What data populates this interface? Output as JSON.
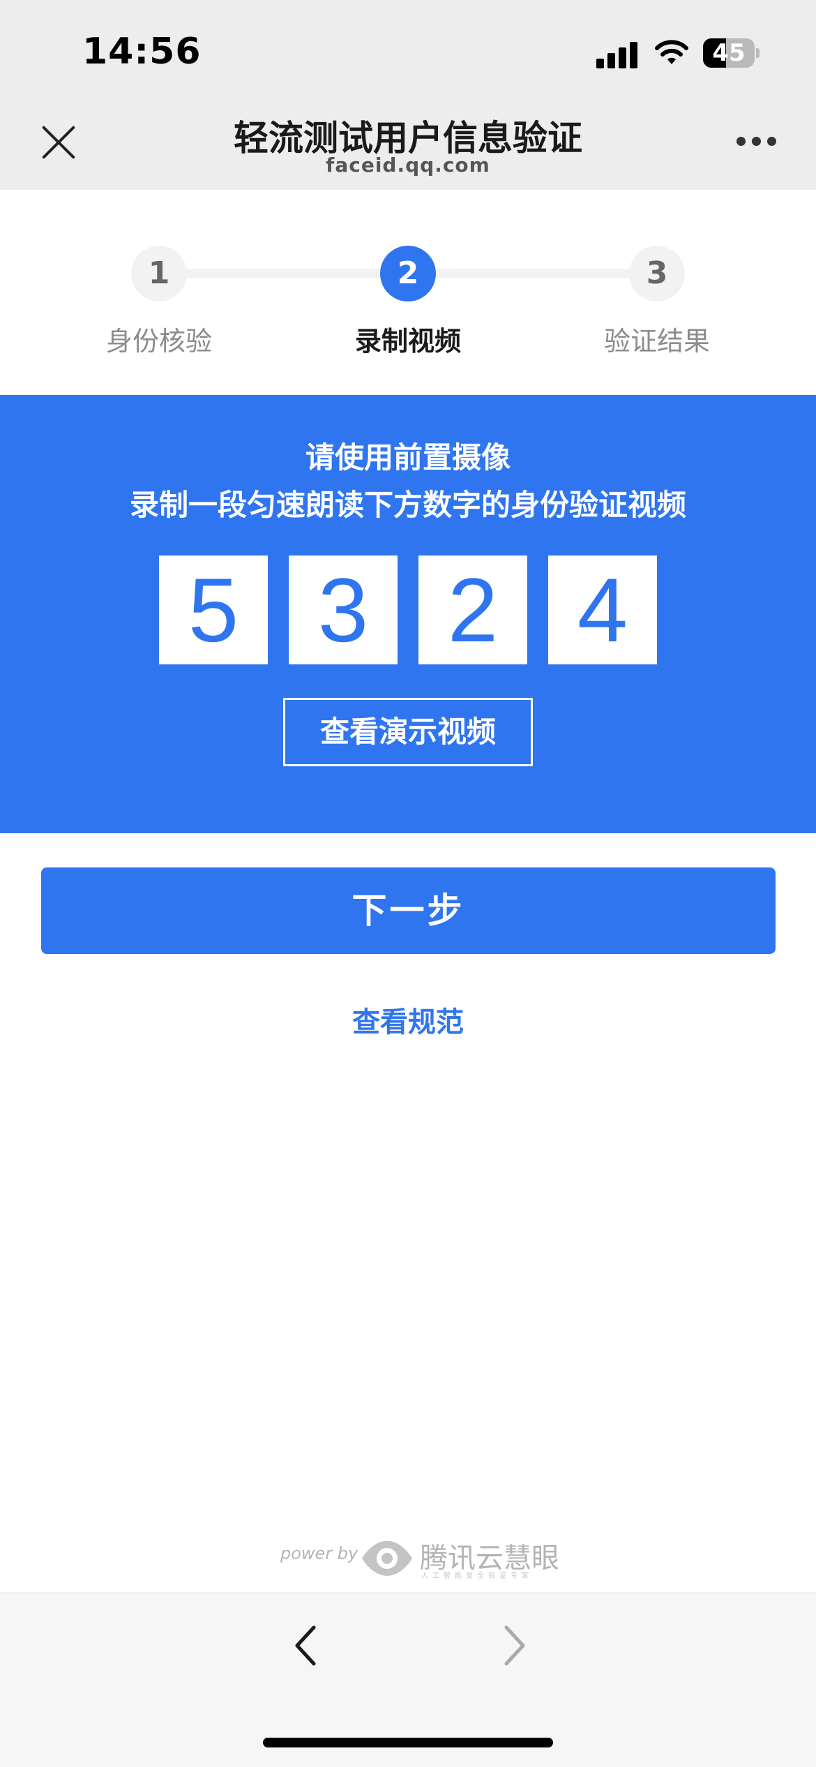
{
  "status_bar": {
    "time": "14:56",
    "battery": "45",
    "battery_level_percent": 45
  },
  "header": {
    "title": "轻流测试用户信息验证",
    "subtitle": "faceid.qq.com"
  },
  "steps": [
    {
      "number": "1",
      "label": "身份核验",
      "state": "done"
    },
    {
      "number": "2",
      "label": "录制视频",
      "state": "active"
    },
    {
      "number": "3",
      "label": "验证结果",
      "state": "pending"
    }
  ],
  "instructions": {
    "line1": "请使用前置摄像",
    "line2": "录制一段匀速朗读下方数字的身份验证视频"
  },
  "digits": [
    "5",
    "3",
    "2",
    "4"
  ],
  "demo_button": "查看演示视频",
  "next_button": "下一步",
  "spec_link": "查看规范",
  "footer": {
    "power_by": "power by",
    "brand": "腾讯云慧眼",
    "tagline": "人工智能安全验证专家"
  },
  "colors": {
    "accent": "#2f75ef",
    "header_bg": "#ededed",
    "step_track": "#f2f2f2"
  },
  "icons": {
    "close": "close-icon",
    "more": "more-icon",
    "back": "chevron-left-icon",
    "forward": "chevron-right-icon",
    "signal": "signal-icon",
    "wifi": "wifi-icon",
    "battery": "battery-icon",
    "logo": "eye-logo-icon"
  }
}
